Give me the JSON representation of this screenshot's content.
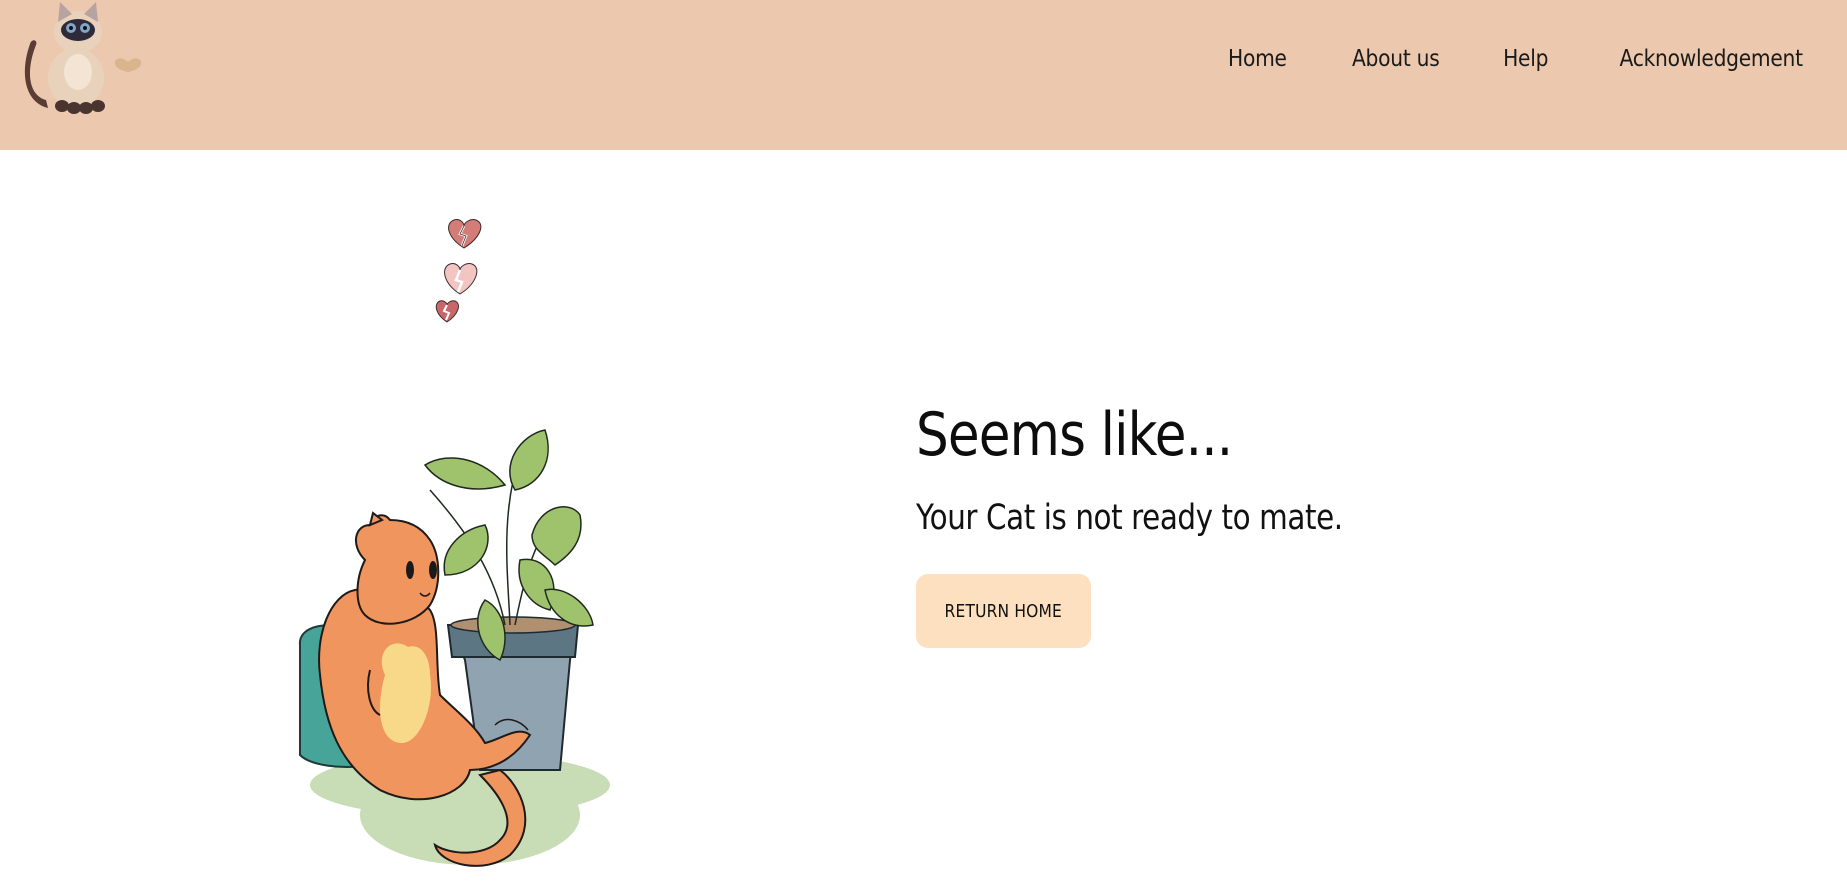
{
  "header": {
    "logo_icon": "siamese-cat-logo",
    "nav": [
      {
        "label": "Home"
      },
      {
        "label": "About us"
      },
      {
        "label": "Help"
      },
      {
        "label": "Acknowledgement"
      }
    ]
  },
  "main": {
    "title": "Seems like...",
    "message": "Your Cat is not ready to mate.",
    "button_label": "RETURN HOME",
    "decor_icon": "broken-hearts",
    "illustration_icon": "sad-orange-cat-with-plant"
  },
  "colors": {
    "header_bg": "#ecc9ae",
    "button_bg": "#fde0c0",
    "cat_orange": "#f0955e",
    "pillow_teal": "#46a598",
    "pot_blue": "#8fa3b0",
    "leaf_green": "#9fc36c"
  }
}
